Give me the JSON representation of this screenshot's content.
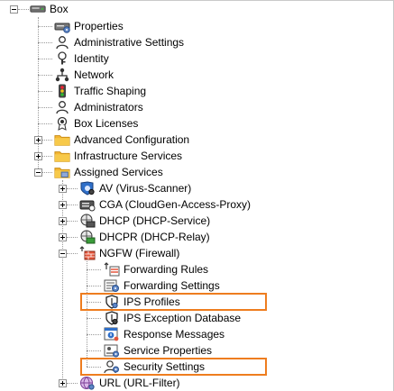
{
  "tree": {
    "root": {
      "label": "Box",
      "icon": "server-box-icon"
    },
    "box_children": [
      {
        "label": "Properties",
        "icon": "properties-icon"
      },
      {
        "label": "Administrative Settings",
        "icon": "admin-user-icon"
      },
      {
        "label": "Identity",
        "icon": "identity-icon"
      },
      {
        "label": "Network",
        "icon": "network-icon"
      },
      {
        "label": "Traffic Shaping",
        "icon": "traffic-light-icon"
      },
      {
        "label": "Administrators",
        "icon": "administrators-icon"
      },
      {
        "label": "Box Licenses",
        "icon": "license-seal-icon"
      },
      {
        "label": "Advanced Configuration",
        "icon": "folder-icon"
      },
      {
        "label": "Infrastructure Services",
        "icon": "folder-icon"
      },
      {
        "label": "Assigned Services",
        "icon": "services-folder-icon"
      }
    ],
    "services": [
      {
        "label": "AV (Virus-Scanner)",
        "icon": "virus-scanner-icon"
      },
      {
        "label": "CGA (CloudGen-Access-Proxy)",
        "icon": "access-proxy-icon"
      },
      {
        "label": "DHCP (DHCP-Service)",
        "icon": "dhcp-service-icon"
      },
      {
        "label": "DHCPR (DHCP-Relay)",
        "icon": "dhcp-relay-icon"
      },
      {
        "label": "NGFW (Firewall)",
        "icon": "firewall-icon"
      },
      {
        "label": "URL (URL-Filter)",
        "icon": "url-filter-icon"
      }
    ],
    "firewall_children": [
      {
        "label": "Forwarding Rules",
        "icon": "forwarding-rules-icon"
      },
      {
        "label": "Forwarding Settings",
        "icon": "forwarding-settings-icon"
      },
      {
        "label": "IPS Profiles",
        "icon": "ips-shield-icon"
      },
      {
        "label": "IPS Exception Database",
        "icon": "ips-exception-icon"
      },
      {
        "label": "Response Messages",
        "icon": "response-messages-icon"
      },
      {
        "label": "Service Properties",
        "icon": "service-properties-icon"
      },
      {
        "label": "Security Settings",
        "icon": "security-settings-icon"
      }
    ],
    "highlight_color": "#ee7d1f"
  }
}
